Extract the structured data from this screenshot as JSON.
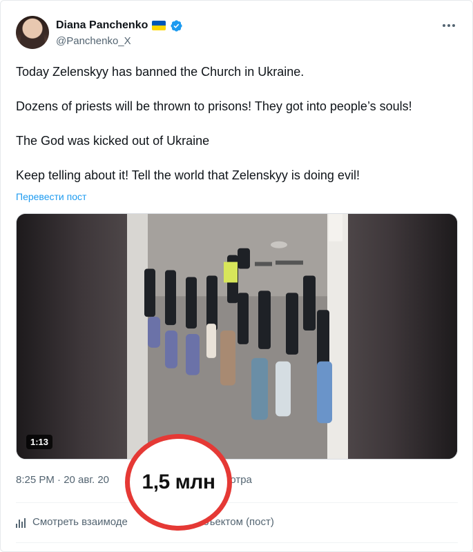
{
  "author": {
    "name": "Diana Panchenko",
    "handle": "@Panchenko_X",
    "verified": true,
    "flag": "ukraine-flag-icon"
  },
  "post": {
    "paragraphs": [
      "Today Zelenskyy has banned the Church in Ukraine.",
      "Dozens of priests will be thrown to prisons! They got into people’s souls!",
      "The God was kicked out of Ukraine",
      "Keep telling about it! Tell the world that Zelenskyy is doing evil!"
    ],
    "translate_label": "Перевести пост"
  },
  "video": {
    "duration": "1:13"
  },
  "meta": {
    "timestamp_visible": "8:25 PM · 20 авг. 20",
    "views_suffix_visible": "мотра",
    "views_highlight": "1,5 млн"
  },
  "engagement": {
    "label_left": "Смотреть взаимоде",
    "label_right": "бъектом (пост)"
  },
  "colors": {
    "accent": "#1d9bf0",
    "secondary_text": "#536471",
    "highlight_circle": "#e53935"
  }
}
